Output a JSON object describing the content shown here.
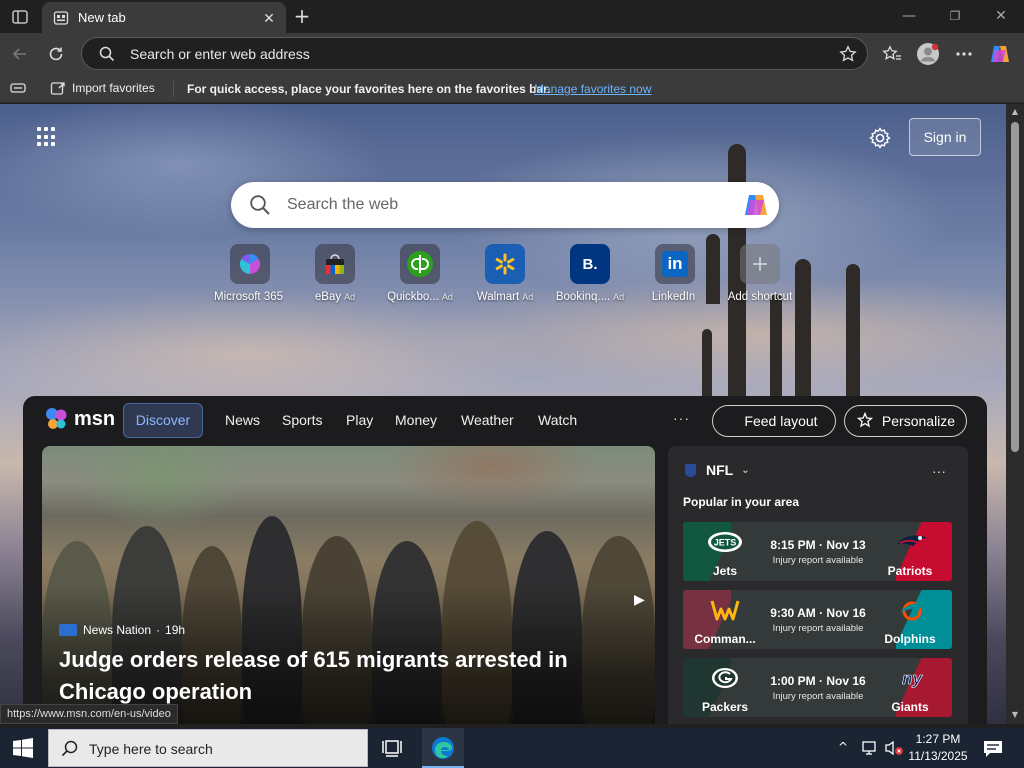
{
  "tabbar": {
    "tab_title": "New tab",
    "close_glyph": "✕",
    "new_tab_glyph": "+",
    "window_controls": {
      "minimize": "—",
      "maximize": "❐",
      "close": "✕"
    }
  },
  "toolbar": {
    "address_placeholder": "Search or enter web address"
  },
  "favorites_bar": {
    "import_label": "Import favorites",
    "info_text": "For quick access, place your favorites here on the favorites bar.",
    "manage_link": "Manage favorites now"
  },
  "new_tab_page": {
    "signin_label": "Sign in",
    "search_placeholder": "Search the web",
    "shortcuts": [
      {
        "label": "Microsoft 365",
        "ad": "",
        "icon": "microsoft-365-icon"
      },
      {
        "label": "eBay",
        "ad": "Ad",
        "icon": "ebay-icon"
      },
      {
        "label": "Quickbo...",
        "ad": "Ad",
        "icon": "quickbooks-icon"
      },
      {
        "label": "Walmart",
        "ad": "Ad",
        "icon": "walmart-icon"
      },
      {
        "label": "Bookinq....",
        "ad": "Ad",
        "icon": "booking-icon"
      },
      {
        "label": "LinkedIn",
        "ad": "",
        "icon": "linkedin-icon"
      },
      {
        "label": "Add shortcut",
        "ad": "",
        "icon": "add-shortcut-icon"
      }
    ]
  },
  "msn": {
    "logo_text": "msn",
    "nav_tabs": [
      "Discover",
      "News",
      "Sports",
      "Play",
      "Money",
      "Weather",
      "Watch"
    ],
    "more_glyph": "···",
    "feed_layout_label": "Feed layout",
    "personalize_label": "Personalize",
    "hero": {
      "source": "News Nation",
      "age": "19h",
      "title": "Judge orders release of 615 migrants arrested in Chicago operation"
    },
    "nfl": {
      "title": "NFL",
      "subtitle": "Popular in your area",
      "games": [
        {
          "away": "Jets",
          "home": "Patriots",
          "time": "8:15 PM · Nov 13",
          "note": "Injury report available",
          "away_color": "#125740",
          "home_color": "#c60c30"
        },
        {
          "away": "Comman...",
          "home": "Dolphins",
          "time": "9:30 AM · Nov 16",
          "note": "Injury report available",
          "away_color": "#773141",
          "home_color": "#008e97"
        },
        {
          "away": "Packers",
          "home": "Giants",
          "time": "1:00 PM · Nov 16",
          "note": "Injury report available",
          "away_color": "#203731",
          "home_color": "#a71930"
        }
      ]
    }
  },
  "status_url": "https://www.msn.com/en-us/video",
  "taskbar": {
    "search_placeholder": "Type here to search",
    "time": "1:27 PM",
    "date": "11/13/2025"
  }
}
